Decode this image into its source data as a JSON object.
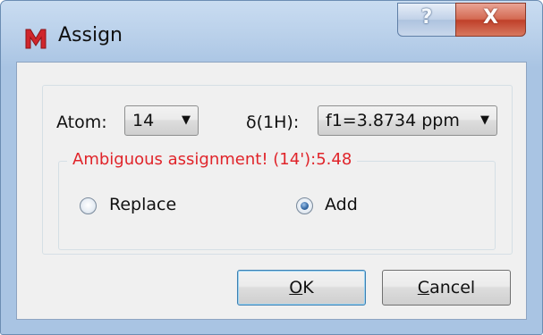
{
  "window": {
    "title": "Assign",
    "help_glyph": "?",
    "close_glyph": "X",
    "app_icon": "mnova-m-icon",
    "accent": "#e0242a"
  },
  "form": {
    "atom_label": "Atom:",
    "atom_value": "14",
    "shift_label": "δ(1H):",
    "shift_value": "f1=3.8734 ppm"
  },
  "assignment": {
    "warning": "Ambiguous assignment! (14'):5.48",
    "options": [
      {
        "label": "Replace",
        "selected": false
      },
      {
        "label": "Add",
        "selected": true
      }
    ]
  },
  "buttons": {
    "ok": {
      "mnemonic": "O",
      "rest": "K"
    },
    "cancel": {
      "mnemonic": "C",
      "rest": "ancel"
    }
  }
}
